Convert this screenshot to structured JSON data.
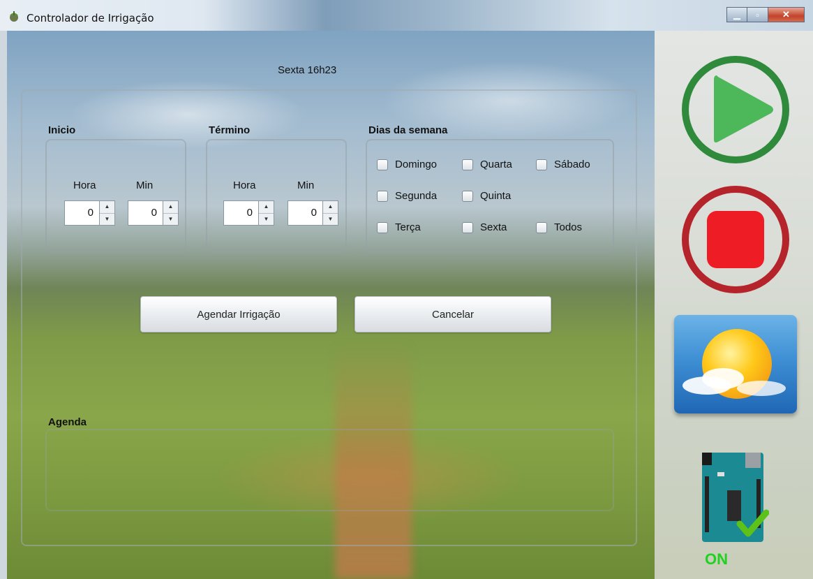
{
  "window": {
    "title": "Controlador de Irrigação",
    "buttons": [
      "minimize",
      "maximize",
      "close"
    ]
  },
  "header": {
    "datetime": "Sexta 16h23"
  },
  "inicio": {
    "title": "Inicio",
    "hora_label": "Hora",
    "min_label": "Min",
    "hora_value": "0",
    "min_value": "0"
  },
  "termino": {
    "title": "Término",
    "hora_label": "Hora",
    "min_label": "Min",
    "hora_value": "0",
    "min_value": "0"
  },
  "dias": {
    "title": "Dias da semana",
    "options": [
      {
        "label": "Domingo",
        "checked": false
      },
      {
        "label": "Quarta",
        "checked": false
      },
      {
        "label": "Sábado",
        "checked": false
      },
      {
        "label": "Segunda",
        "checked": false
      },
      {
        "label": "Quinta",
        "checked": false
      },
      {
        "label": "Terça",
        "checked": false
      },
      {
        "label": "Sexta",
        "checked": false
      },
      {
        "label": "Todos",
        "checked": false
      }
    ]
  },
  "actions": {
    "schedule_label": "Agendar Irrigação",
    "cancel_label": "Cancelar"
  },
  "agenda": {
    "title": "Agenda"
  },
  "sidebar": {
    "status_label": "ON",
    "icons": [
      "play-icon",
      "stop-icon",
      "weather-icon",
      "arduino-board-icon"
    ],
    "colors": {
      "play": "#2f8a3b",
      "stop": "#ee1c24",
      "status": "#1fd21f"
    }
  }
}
